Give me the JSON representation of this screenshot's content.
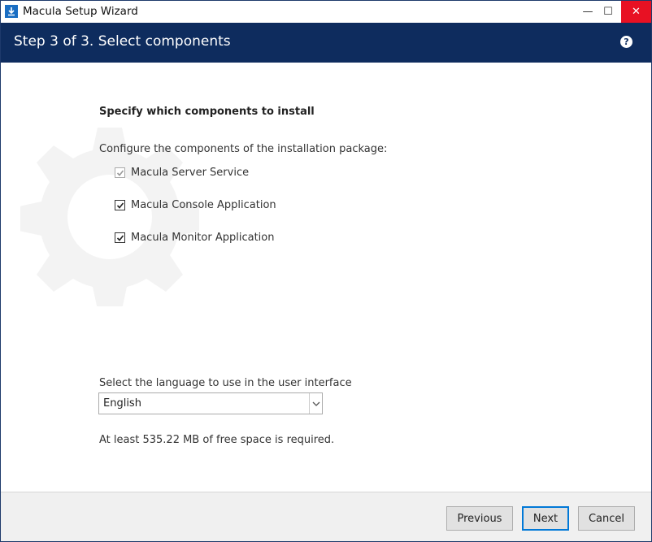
{
  "window": {
    "title": "Macula Setup Wizard",
    "minimize": "—",
    "maximize": "☐",
    "close": "✕"
  },
  "header": {
    "step_title": "Step 3 of 3. Select components",
    "help": "?"
  },
  "main": {
    "heading": "Specify which components to install",
    "description": "Configure the components of the installation package:",
    "components": [
      {
        "label": "Macula Server Service",
        "checked": true,
        "disabled": true
      },
      {
        "label": "Macula Console Application",
        "checked": true,
        "disabled": false
      },
      {
        "label": "Macula Monitor Application",
        "checked": true,
        "disabled": false
      }
    ],
    "language_label": "Select the language to use in the user interface",
    "language_value": "English",
    "space_text": "At least 535.22 MB of free space is required."
  },
  "footer": {
    "previous": "Previous",
    "next": "Next",
    "cancel": "Cancel"
  },
  "colors": {
    "header_bg": "#0e2c5e",
    "close_bg": "#e81123",
    "focus": "#0078d7"
  }
}
